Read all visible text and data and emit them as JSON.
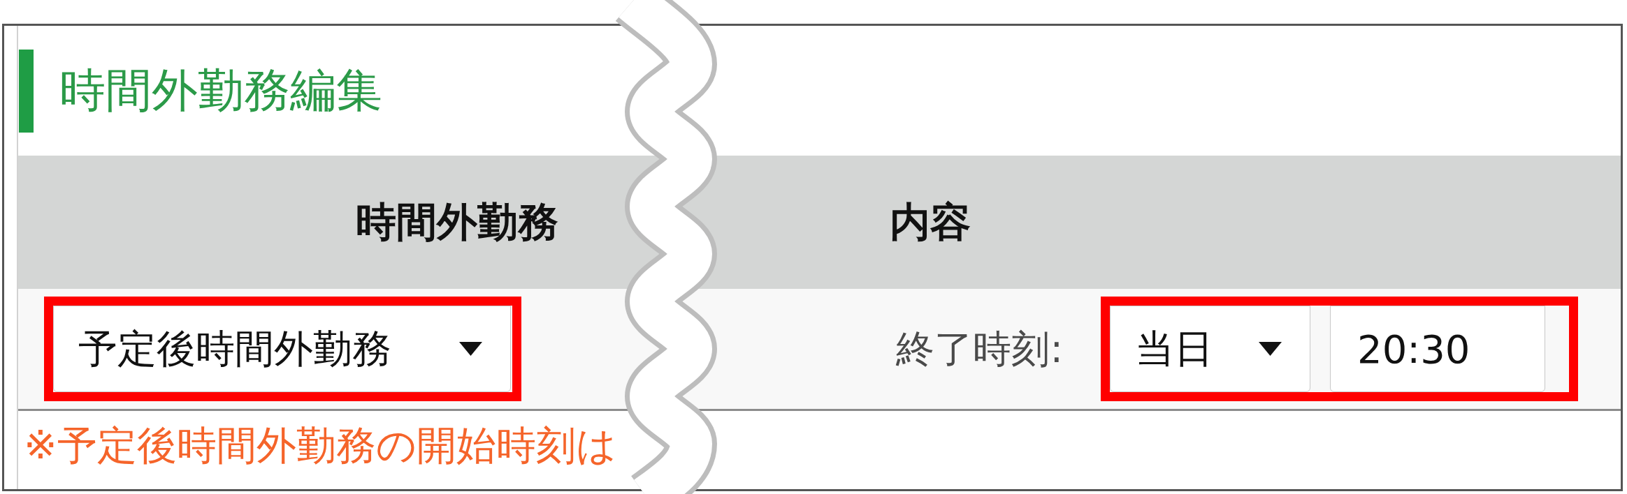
{
  "title": "時間外勤務編集",
  "table": {
    "columns": [
      "時間外勤務",
      "内容"
    ],
    "rows": [
      {
        "overtime_type": {
          "value": "予定後時間外勤務",
          "highlighted": true
        },
        "end_time": {
          "label": "終了時刻:",
          "highlighted": true,
          "day": {
            "value": "当日"
          },
          "time": {
            "value": "20:30"
          }
        }
      }
    ]
  },
  "note": "※予定後時間外勤務の開始時刻は"
}
